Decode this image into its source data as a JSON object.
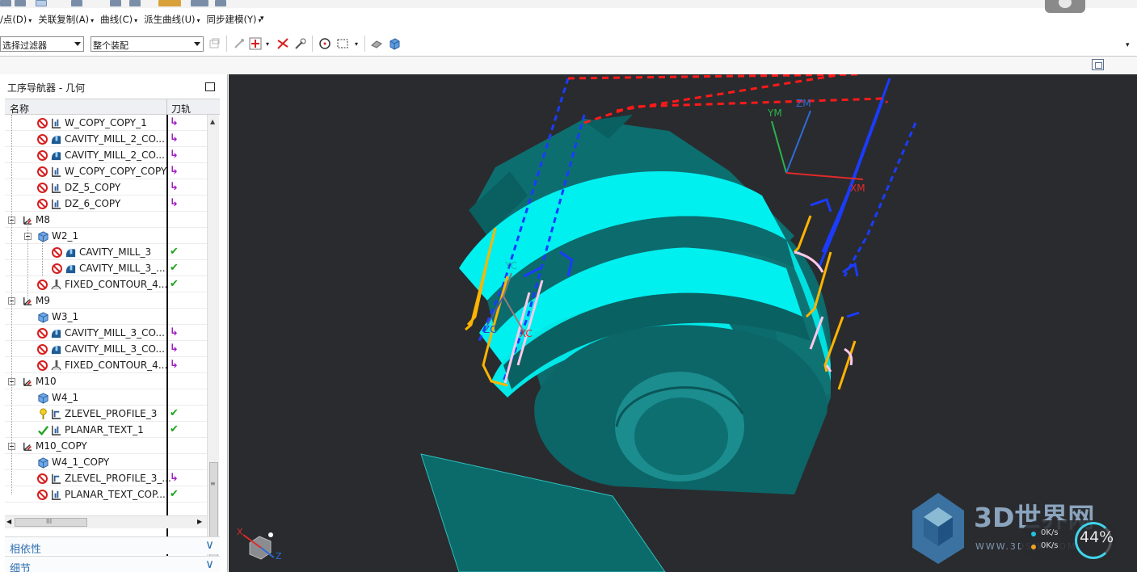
{
  "menu": {
    "items": [
      {
        "label": "/点(D)",
        "dd": "▾"
      },
      {
        "label": "关联复制(A)",
        "dd": "▾"
      },
      {
        "label": "曲线(C)",
        "dd": "▾"
      },
      {
        "label": "派生曲线(U)",
        "dd": "▾"
      },
      {
        "label": "同步建模(Y)",
        "dd": "▾"
      }
    ],
    "overflow": "▾"
  },
  "filter": {
    "selection_filter": "选择过滤器",
    "assembly_scope": "整个装配"
  },
  "navigator": {
    "title": "工序导航器 - 几何",
    "col_name": "名称",
    "col_toolpath": "刀轨",
    "rows": [
      {
        "label": "W_COPY_COPY_1",
        "status": "prohib",
        "type": "planar",
        "path": "↳"
      },
      {
        "label": "CAVITY_MILL_2_CO...",
        "status": "prohib",
        "type": "cavity",
        "path": "↳"
      },
      {
        "label": "CAVITY_MILL_2_CO...",
        "status": "prohib",
        "type": "cavity",
        "path": "↳"
      },
      {
        "label": "W_COPY_COPY_COPY",
        "status": "prohib",
        "type": "planar",
        "path": "↳"
      },
      {
        "label": "DZ_5_COPY",
        "status": "prohib",
        "type": "planar",
        "path": "↳"
      },
      {
        "label": "DZ_6_COPY",
        "status": "prohib",
        "type": "planar",
        "path": "↳"
      },
      {
        "label": "M8",
        "status": "mcs",
        "type": "group",
        "path": ""
      },
      {
        "label": "W2_1",
        "status": "workpiece",
        "type": "group",
        "path": ""
      },
      {
        "label": "CAVITY_MILL_3",
        "status": "prohib",
        "type": "cavity",
        "path": "✔"
      },
      {
        "label": "CAVITY_MILL_3_...",
        "status": "prohib",
        "type": "cavity",
        "path": "✔"
      },
      {
        "label": "FIXED_CONTOUR_4...",
        "status": "prohib",
        "type": "contour",
        "path": "✔"
      },
      {
        "label": "M9",
        "status": "mcs",
        "type": "group",
        "path": ""
      },
      {
        "label": "W3_1",
        "status": "workpiece",
        "type": "group",
        "path": ""
      },
      {
        "label": "CAVITY_MILL_3_CO...",
        "status": "prohib",
        "type": "cavity",
        "path": "↳"
      },
      {
        "label": "CAVITY_MILL_3_CO...",
        "status": "prohib",
        "type": "cavity",
        "path": "↳"
      },
      {
        "label": "FIXED_CONTOUR_4...",
        "status": "prohib",
        "type": "contour",
        "path": "↳"
      },
      {
        "label": "M10",
        "status": "mcs",
        "type": "group",
        "path": ""
      },
      {
        "label": "W4_1",
        "status": "workpiece",
        "type": "group",
        "path": ""
      },
      {
        "label": "ZLEVEL_PROFILE_3",
        "status": "warn",
        "type": "zlevel",
        "path": "✔"
      },
      {
        "label": "PLANAR_TEXT_1",
        "status": "ok",
        "type": "planar",
        "path": "✔"
      },
      {
        "label": "M10_COPY",
        "status": "mcs",
        "type": "group",
        "path": ""
      },
      {
        "label": "W4_1_COPY",
        "status": "workpiece",
        "type": "group",
        "path": ""
      },
      {
        "label": "ZLEVEL_PROFILE_3_...",
        "status": "prohib",
        "type": "zlevel",
        "path": "↳"
      },
      {
        "label": "PLANAR_TEXT_COP...",
        "status": "prohib",
        "type": "planar",
        "path": "✔"
      }
    ],
    "hscroll_mark": "III",
    "dependency_panel": "相依性",
    "details_panel": "细节",
    "chevron": "∨"
  },
  "viewport": {
    "csys_labels": {
      "ym": "YM",
      "zm": "ZM",
      "xm": "XM",
      "yc": "YC",
      "zc": "ZC",
      "xc": "XC"
    },
    "triad_labels": {
      "x": "X",
      "z": "Z"
    },
    "watermark_main": "3D世界网",
    "watermark_url": "WWW.3DSJW.COM",
    "net": {
      "up": "0K/s",
      "down": "0K/s",
      "percent": "44%"
    },
    "colors": {
      "part": "#0a6f70",
      "part_light": "#00f0f0",
      "background": "#2a2b2e",
      "toolpath_blue": "#1a3cff",
      "toolpath_red": "#ff1a1a",
      "toolpath_orange": "#ffb400"
    }
  }
}
